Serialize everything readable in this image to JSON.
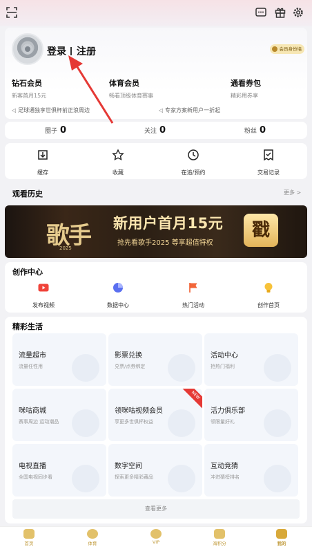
{
  "profile": {
    "login": "登录",
    "register": "注册",
    "badge": "会员身份墙"
  },
  "memberships": [
    {
      "title": "钻石会员",
      "subtitle": "新客首月15元"
    },
    {
      "title": "体育会员",
      "subtitle": "畅看顶级体育赛事"
    },
    {
      "title": "通看券包",
      "subtitle": "精彩用券享"
    }
  ],
  "notices": [
    "足球通独享世俱杯前正浪周边",
    "专家方案新用户一折起"
  ],
  "stats": [
    {
      "label": "圈子",
      "value": "0"
    },
    {
      "label": "关注",
      "value": "0"
    },
    {
      "label": "粉丝",
      "value": "0"
    }
  ],
  "actions": [
    "缓存",
    "收藏",
    "在追/预约",
    "交易记录"
  ],
  "history": {
    "title": "观看历史",
    "more": "更多 >"
  },
  "banner": {
    "logo": "歌手",
    "year": "2025",
    "headline": "新用户首月15元",
    "subline": "抢先看歌手2025 尊享超值特权",
    "cta": "戳"
  },
  "creation": {
    "title": "创作中心",
    "items": [
      "发布视频",
      "数据中心",
      "热门活动",
      "创作首页"
    ]
  },
  "life": {
    "title": "精彩生活",
    "tiles": [
      {
        "title": "流量超市",
        "subtitle": "流量任性用"
      },
      {
        "title": "影票兑换",
        "subtitle": "兑票/点券绑定"
      },
      {
        "title": "活动中心",
        "subtitle": "抢热门福利"
      },
      {
        "title": "咪咕商城",
        "subtitle": "赛事周边 运动潮品"
      },
      {
        "title": "领咪咕视频会员",
        "subtitle": "享更多世俱杯权益",
        "tag": "NEW"
      },
      {
        "title": "活力俱乐部",
        "subtitle": "领限量好礼"
      },
      {
        "title": "电视直播",
        "subtitle": "全国电视同步看"
      },
      {
        "title": "数字空间",
        "subtitle": "探索更多精彩藏品"
      },
      {
        "title": "互动竞猜",
        "subtitle": "冲进猜榜排名"
      }
    ],
    "more": "查看更多"
  },
  "tabs": [
    "首页",
    "体育",
    "VIP",
    "海积分",
    "我的"
  ],
  "colors": {
    "accent": "#c09a3a",
    "arrow": "#e53935",
    "tile_bg": "#f3f6fb"
  }
}
